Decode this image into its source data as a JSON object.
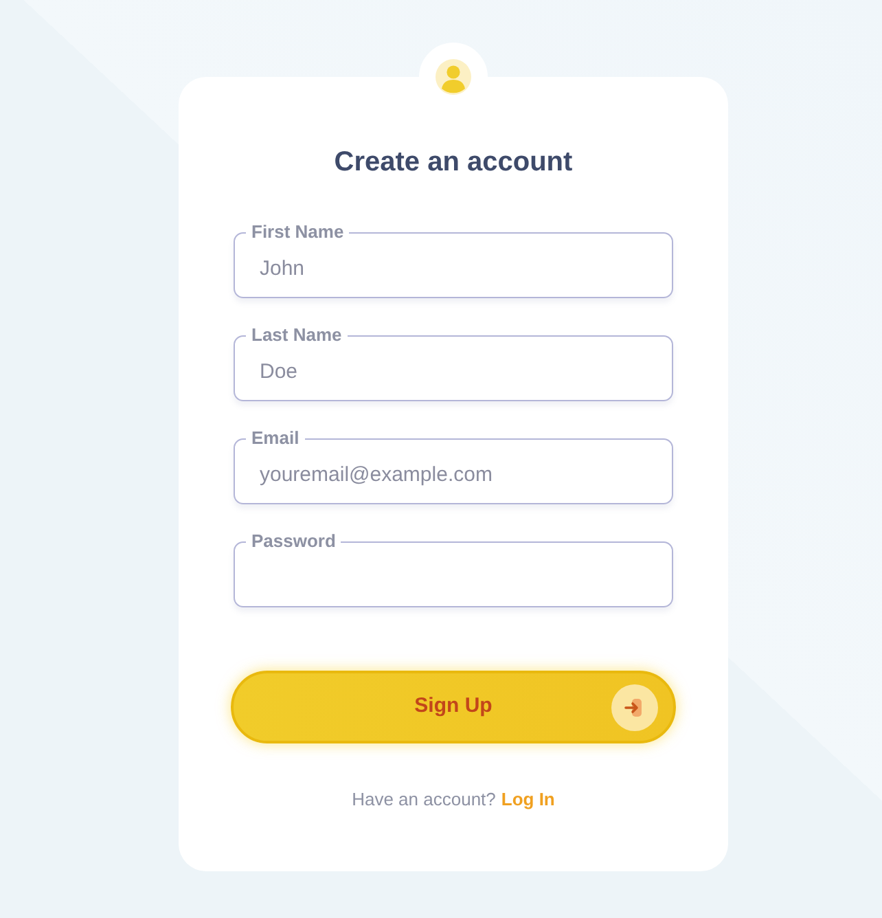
{
  "title": "Create an account",
  "fields": [
    {
      "label": "First Name",
      "placeholder": "John"
    },
    {
      "label": "Last Name",
      "placeholder": "Doe"
    },
    {
      "label": "Email",
      "placeholder": "youremail@example.com"
    },
    {
      "label": "Password"
    }
  ],
  "submit_button": {
    "label": "Sign Up"
  },
  "footer": {
    "text": "Have an account?",
    "link": "Log In"
  }
}
